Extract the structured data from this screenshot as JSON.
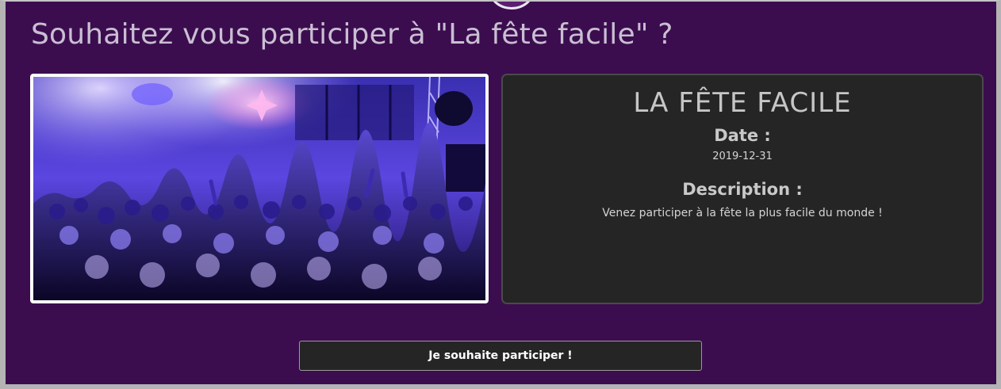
{
  "page": {
    "title": "Souhaitez vous participer à \"La fête facile\" ?"
  },
  "event": {
    "name": "LA FÊTE FACILE",
    "date_label": "Date :",
    "date_value": "2019-12-31",
    "description_label": "Description :",
    "description_value": "Venez participer à la fête la plus facile du monde !"
  },
  "actions": {
    "participate_label": "Je souhaite participer !"
  },
  "colors": {
    "page_background": "#3b0d4f",
    "card_background": "#262526",
    "title_text": "#c9bfd2"
  }
}
